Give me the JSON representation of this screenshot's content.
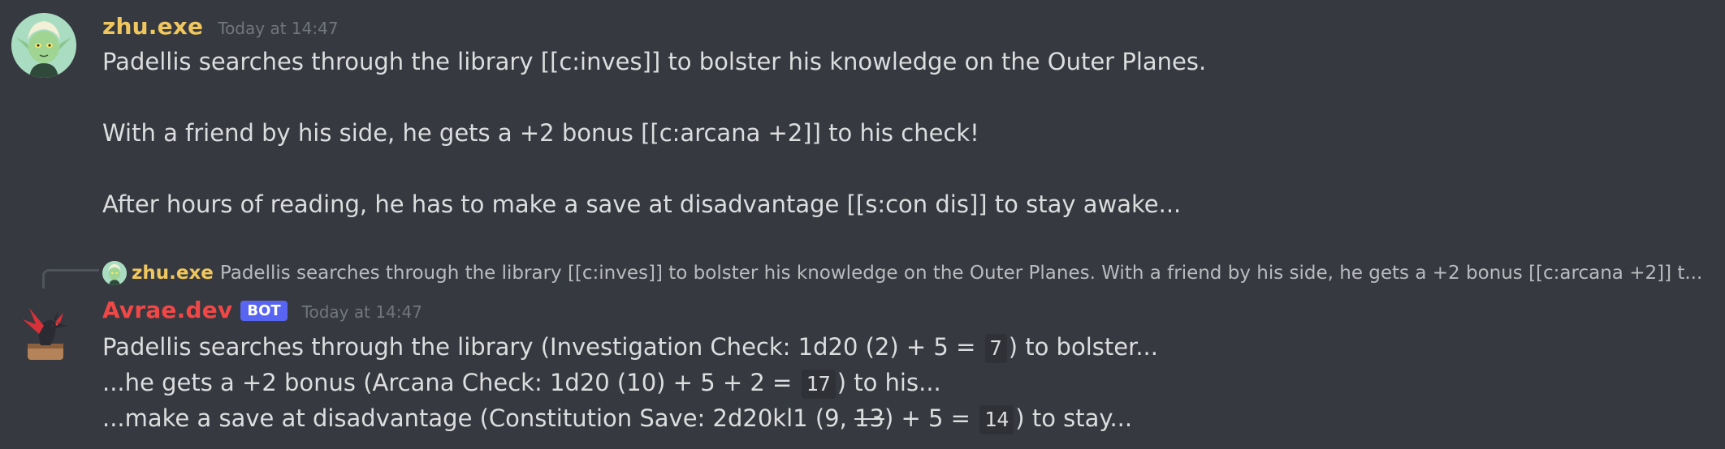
{
  "messages": [
    {
      "author": "zhu.exe",
      "timestamp": "Today at 14:47",
      "lines": [
        "Padellis searches through the library [[c:inves]] to bolster his knowledge on the Outer Planes.",
        "With a friend by his side, he gets a +2 bonus [[c:arcana +2]] to his check!",
        "After hours of reading, he has to make a save at disadvantage [[s:con dis]] to stay awake..."
      ]
    },
    {
      "reply": {
        "author": "zhu.exe",
        "text": "Padellis searches through the library [[c:inves]] to bolster his knowledge on the Outer Planes.   With a friend by his side, he gets a +2 bonus [[c:arcana +2]] t..."
      },
      "author": "Avrae.dev",
      "bot_tag": "BOT",
      "timestamp": "Today at 14:47",
      "rolls": [
        {
          "before": "Padellis searches through the library (Investigation Check: 1d20 (2) + 5 = ",
          "result": "7",
          "after": ") to bolster..."
        },
        {
          "before": "...he gets a +2 bonus (Arcana Check: 1d20 (10) + 5 + 2 = ",
          "result": "17",
          "after": ") to his..."
        },
        {
          "before": "...make a save at disadvantage (Constitution Save: 2d20kl1 (9, ",
          "struck": "13",
          "mid": ") + 5 = ",
          "result": "14",
          "after": ") to stay..."
        }
      ]
    }
  ],
  "colors": {
    "background": "#36393f",
    "zhu_name": "#f0c75e",
    "avrae_name": "#f04747",
    "bot_tag": "#5865f2",
    "text": "#dcddde",
    "muted": "#72767d"
  },
  "icons": {
    "user_avatar": "green-elf-avatar-icon",
    "bot_avatar": "red-dragon-avatar-icon"
  }
}
